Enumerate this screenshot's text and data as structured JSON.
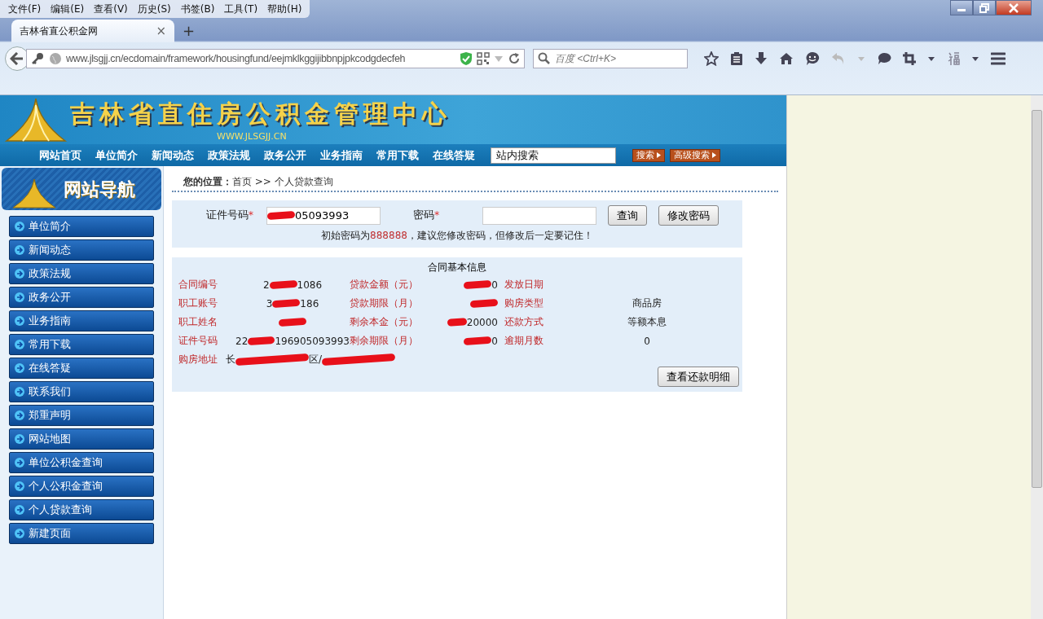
{
  "browser": {
    "menu": [
      "文件(F)",
      "编辑(E)",
      "查看(V)",
      "历史(S)",
      "书签(B)",
      "工具(T)",
      "帮助(H)"
    ],
    "tab": {
      "title": "吉林省直公积金网",
      "close": "×"
    },
    "new_tab": "+",
    "url": "www.jlsgjj.cn/ecdomain/framework/housingfund/eejmklkggijibbnpjpkcodgdecfeh",
    "search": {
      "placeholder": "百度 <Ctrl+K>"
    }
  },
  "site": {
    "title": "吉林省直住房公积金管理中心",
    "domain": "WWW.JLSGJJ.CN",
    "nav": [
      "网站首页",
      "单位简介",
      "新闻动态",
      "政策法规",
      "政务公开",
      "业务指南",
      "常用下载",
      "在线答疑"
    ],
    "search": {
      "placeholder": "站内搜索"
    },
    "search_button": "搜索",
    "advanced_button": "高级搜索"
  },
  "sidebar": {
    "title": "网站导航",
    "items": [
      {
        "label": "单位简介"
      },
      {
        "label": "新闻动态"
      },
      {
        "label": "政策法规"
      },
      {
        "label": "政务公开"
      },
      {
        "label": "业务指南"
      },
      {
        "label": "常用下载"
      },
      {
        "label": "在线答疑"
      },
      {
        "label": "联系我们"
      },
      {
        "label": "郑重声明"
      },
      {
        "label": "网站地图"
      },
      {
        "label": "单位公积金查询"
      },
      {
        "label": "个人公积金查询"
      },
      {
        "label": "个人贷款查询"
      },
      {
        "label": "新建页面"
      }
    ]
  },
  "breadcrumb": {
    "label": "您的位置：",
    "path": "首页 >> 个人贷款查询"
  },
  "login": {
    "id_label": "证件号码",
    "required_mark": "*",
    "id_value": [
      {
        "kind": "redaction"
      },
      {
        "kind": "text",
        "text": "05093993"
      }
    ],
    "password_label": "密码",
    "password_required_mark": "*",
    "query_button": "查询",
    "change_button": "修改密码",
    "notice_before": "初始密码为",
    "notice_code": "888888",
    "notice_after": "，建议您修改密码，但修改后一定要记住！"
  },
  "contract": {
    "title": "合同基本信息",
    "rows": [
      [
        {
          "label": "合同编号",
          "value": [
            {
              "kind": "text",
              "text": "2"
            },
            {
              "kind": "redaction"
            },
            {
              "kind": "text",
              "text": "1086"
            }
          ]
        },
        {
          "label": "贷款金额（元）",
          "value": [
            {
              "kind": "redaction"
            },
            {
              "kind": "text",
              "text": "0"
            }
          ]
        },
        {
          "label": "发放日期"
        }
      ],
      [
        {
          "label": "职工账号",
          "value": [
            {
              "kind": "text",
              "text": "3"
            },
            {
              "kind": "redaction"
            },
            {
              "kind": "text",
              "text": "186"
            }
          ]
        },
        {
          "label": "贷款期限（月）",
          "value": [
            {
              "kind": "redaction"
            }
          ]
        },
        {
          "label": "购房类型",
          "value": [
            {
              "kind": "text",
              "text": "商品房"
            }
          ]
        }
      ],
      [
        {
          "label": "职工姓名",
          "value": [
            {
              "kind": "redaction"
            }
          ]
        },
        {
          "label": "剩余本金（元）",
          "value": [
            {
              "kind": "redaction"
            },
            {
              "kind": "text",
              "text": "20000"
            }
          ]
        },
        {
          "label": "还款方式",
          "value": [
            {
              "kind": "text",
              "text": "等额本息"
            }
          ]
        }
      ],
      [
        {
          "label": "证件号码",
          "value": [
            {
              "kind": "text",
              "text": "22"
            },
            {
              "kind": "redaction"
            },
            {
              "kind": "text",
              "text": "196905093993"
            }
          ]
        },
        {
          "label": "剩余期限（月）",
          "value": [
            {
              "kind": "redaction"
            },
            {
              "kind": "text",
              "text": "0"
            }
          ]
        },
        {
          "label": "逾期月数",
          "value": [
            {
              "kind": "text",
              "text": "0"
            }
          ]
        }
      ]
    ],
    "address": {
      "label": "购房地址",
      "value": [
        {
          "kind": "text",
          "text": "长"
        },
        {
          "kind": "redaction"
        },
        {
          "kind": "text",
          "text": "区/"
        },
        {
          "kind": "redaction"
        }
      ]
    },
    "detail_button": "查看还款明细"
  }
}
